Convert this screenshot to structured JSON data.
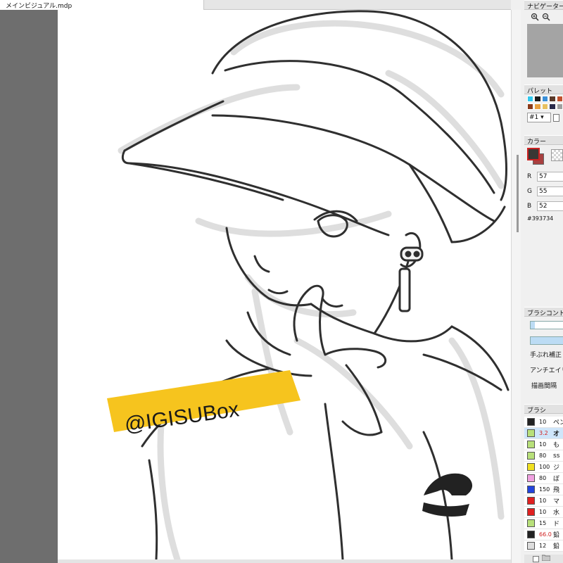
{
  "document": {
    "tab_title": "メインビジュアル.mdp"
  },
  "artwork": {
    "watermark_text": "@IGISUBox"
  },
  "navigator": {
    "title": "ナビゲーター"
  },
  "palette": {
    "title": "パレット",
    "selected": "#1",
    "swatches_row1": [
      "#31c8ee",
      "#1c1c1c",
      "#3a8fd8",
      "#5a3a2a",
      "#c0502e"
    ],
    "swatches_row2": [
      "#8a3a1a",
      "#e8a040",
      "#e8c060",
      "#2a2a4a",
      "#a0a0a0"
    ]
  },
  "color": {
    "title": "カラー",
    "r_label": "R",
    "r": "57",
    "g_label": "G",
    "g": "55",
    "b_label": "B",
    "b": "52",
    "hex": "#393734",
    "foreground": "#393734",
    "background": "#a84040"
  },
  "brush_control": {
    "title": "ブラシコントロール",
    "size_fill": 0.12,
    "opacity_fill": 1.0,
    "stabilizer_label": "手ぶれ補正",
    "antialias_label": "アンチエイリアス",
    "interval_label": "描画間隔"
  },
  "brush_list": {
    "title": "ブラシ",
    "items": [
      {
        "size": "10",
        "name": "ペン",
        "color": "#222222",
        "size_color": "#111111",
        "selected": false
      },
      {
        "size": "3.2",
        "name": "オ",
        "color": "#b8e07a",
        "size_color": "#d02020",
        "selected": true
      },
      {
        "size": "10",
        "name": "も",
        "color": "#b8e07a",
        "size_color": "#111111",
        "selected": false
      },
      {
        "size": "80",
        "name": "ss",
        "color": "#b8e07a",
        "size_color": "#111111",
        "selected": false
      },
      {
        "size": "100",
        "name": "ジ",
        "color": "#f0e020",
        "size_color": "#111111",
        "selected": false
      },
      {
        "size": "80",
        "name": "ぼ",
        "color": "#f0a0e0",
        "size_color": "#111111",
        "selected": false
      },
      {
        "size": "150",
        "name": "飛",
        "color": "#2244dd",
        "size_color": "#111111",
        "selected": false
      },
      {
        "size": "10",
        "name": "マ",
        "color": "#e02020",
        "size_color": "#111111",
        "selected": false
      },
      {
        "size": "10",
        "name": "水",
        "color": "#e02020",
        "size_color": "#111111",
        "selected": false
      },
      {
        "size": "15",
        "name": "ド",
        "color": "#b8e07a",
        "size_color": "#111111",
        "selected": false
      },
      {
        "size": "66.0",
        "name": "鉛",
        "color": "#222222",
        "size_color": "#d02020",
        "selected": false
      },
      {
        "size": "12",
        "name": "鉛",
        "color": "#dddddd",
        "size_color": "#111111",
        "selected": false
      }
    ]
  },
  "icons": [
    "zoom-in-icon",
    "zoom-out-icon",
    "new-page-icon",
    "folder-icon"
  ]
}
